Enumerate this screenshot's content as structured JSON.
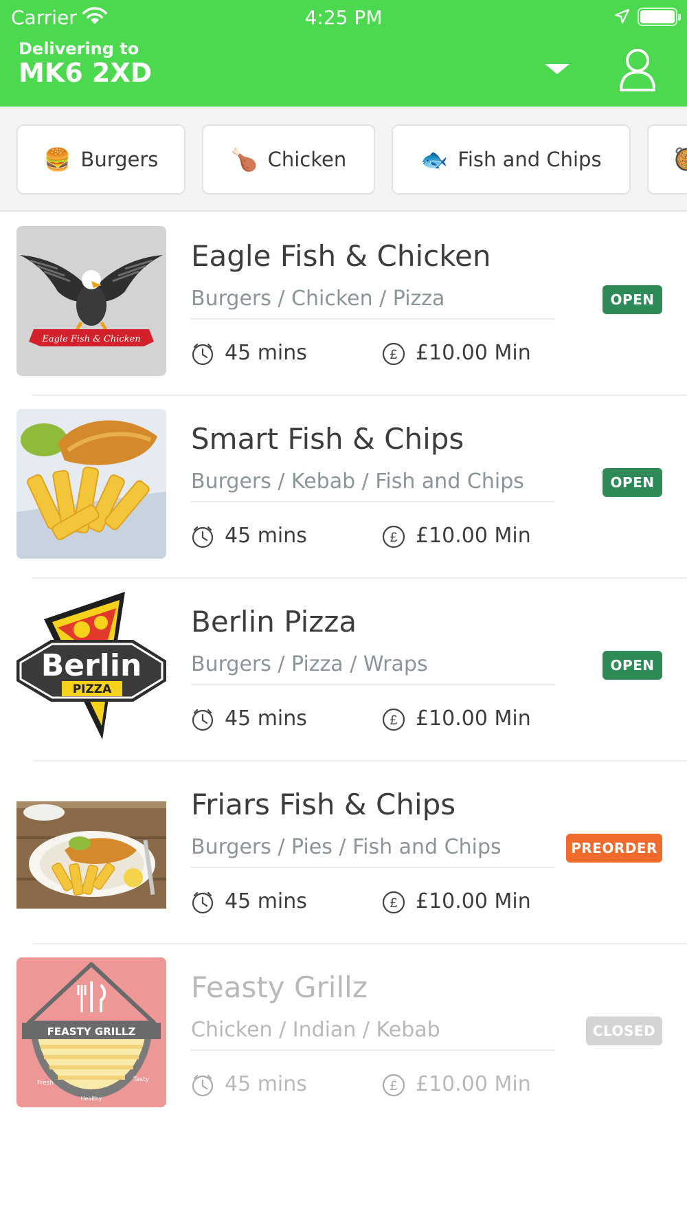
{
  "status_bar": {
    "carrier": "Carrier",
    "time": "4:25 PM"
  },
  "header": {
    "delivering_label": "Delivering to",
    "postcode": "MK6 2XD",
    "accent_color": "#4cd94f"
  },
  "categories": [
    {
      "icon": "burger-icon",
      "glyph": "🍔",
      "label": "Burgers"
    },
    {
      "icon": "chicken-leg-icon",
      "glyph": "🍗",
      "label": "Chicken"
    },
    {
      "icon": "fish-icon",
      "glyph": "🐟",
      "label": "Fish and Chips"
    },
    {
      "icon": "food-icon",
      "glyph": "🥘",
      "label": ""
    }
  ],
  "restaurants": [
    {
      "name": "Eagle Fish & Chicken",
      "cuisines": "Burgers / Chicken / Pizza",
      "delivery_time": "45 mins",
      "min_order": "£10.00 Min",
      "status": "OPEN",
      "image": "eagle-logo"
    },
    {
      "name": "Smart Fish & Chips",
      "cuisines": "Burgers / Kebab / Fish and Chips",
      "delivery_time": "45 mins",
      "min_order": "£10.00 Min",
      "status": "OPEN",
      "image": "fish-and-chips-photo"
    },
    {
      "name": "Berlin Pizza",
      "cuisines": "Burgers / Pizza / Wraps",
      "delivery_time": "45 mins",
      "min_order": "£10.00 Min",
      "status": "OPEN",
      "image": "berlin-pizza-logo"
    },
    {
      "name": "Friars Fish & Chips",
      "cuisines": "Burgers / Pies / Fish and Chips",
      "delivery_time": "45 mins",
      "min_order": "£10.00 Min",
      "status": "PREORDER",
      "image": "fish-plate-photo"
    },
    {
      "name": "Feasty Grillz",
      "cuisines": "Chicken / Indian / Kebab",
      "delivery_time": "45 mins",
      "min_order": "£10.00 Min",
      "status": "CLOSED",
      "image": "feasty-grillz-logo"
    }
  ],
  "logo_text": {
    "eagle": "Eagle Fish & Chicken",
    "berlin_word": "Berlin",
    "berlin_sub": "PIZZA",
    "feasty": "FEASTY GRILLZ",
    "feasty_fresh": "Fresh",
    "feasty_tasty": "Tasty",
    "feasty_healthy": "Healthy"
  },
  "status_colors": {
    "open": "#2e8b58",
    "preorder": "#f06a2c",
    "closed": "#d4d4d4"
  }
}
